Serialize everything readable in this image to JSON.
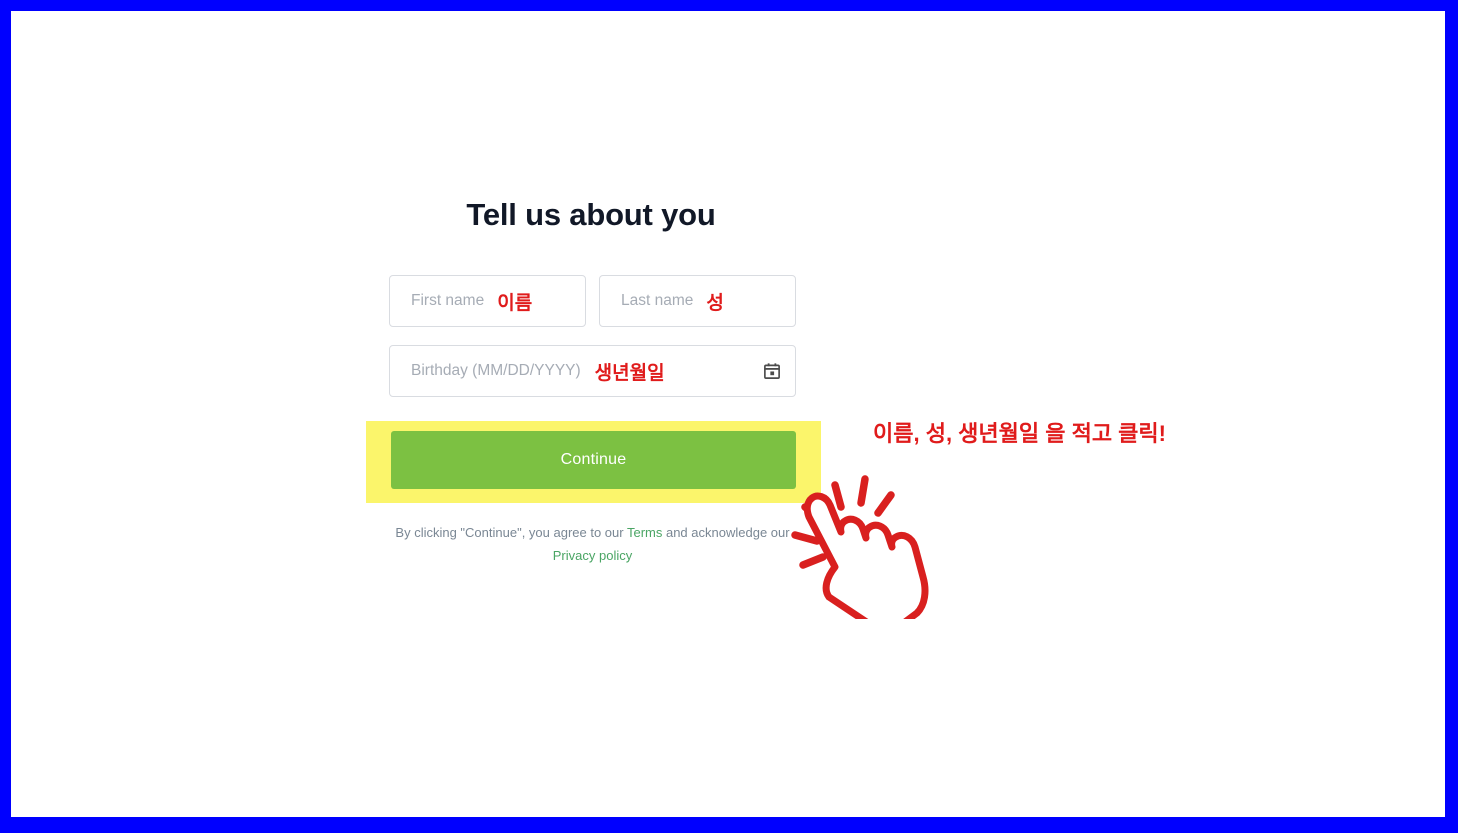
{
  "frame": {
    "border_color": "#0000FF",
    "page_background": "#FFFFFF"
  },
  "form": {
    "heading": "Tell us about you",
    "fields": [
      {
        "name": "first-name",
        "placeholder": "First name",
        "value": "",
        "annotation_ko": "이름"
      },
      {
        "name": "last-name",
        "placeholder": "Last name",
        "value": "",
        "annotation_ko": "성"
      },
      {
        "name": "birthday",
        "placeholder": "Birthday (MM/DD/YYYY)",
        "value": "",
        "annotation_ko": "생년월일",
        "icon": "calendar-icon"
      }
    ],
    "submit": {
      "label": "Continue",
      "background_color": "#7CC142",
      "text_color": "#FFFFFF",
      "highlight_color": "#FBF56B"
    },
    "terms": {
      "line1_prefix": "By clicking \"Continue\", you agree to our ",
      "terms_link": "Terms",
      "line1_suffix": " and",
      "line2_prefix": "acknowledge our ",
      "privacy_link": "Privacy policy",
      "link_color": "#4AA564",
      "text_color": "#7A8794"
    }
  },
  "annotations": {
    "instruction_ko": "이름, 성, 생년월일 을 적고 클릭!",
    "color": "#E01B1B",
    "cursor_icon": "pointing-hand-click-icon"
  }
}
